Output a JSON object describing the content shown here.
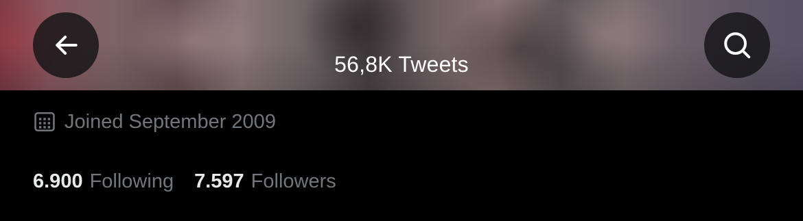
{
  "header": {
    "tweet_count_label": "56,8K Tweets",
    "back_icon": "arrow-left-icon",
    "search_icon": "search-icon"
  },
  "profile": {
    "joined_icon": "calendar-icon",
    "joined_text": "Joined September 2009",
    "following_count": "6.900",
    "following_label": "Following",
    "followers_count": "7.597",
    "followers_label": "Followers"
  },
  "colors": {
    "background": "#000000",
    "primary_text": "#e7e9ea",
    "secondary_text": "#71767b",
    "button_bg": "#141416"
  }
}
